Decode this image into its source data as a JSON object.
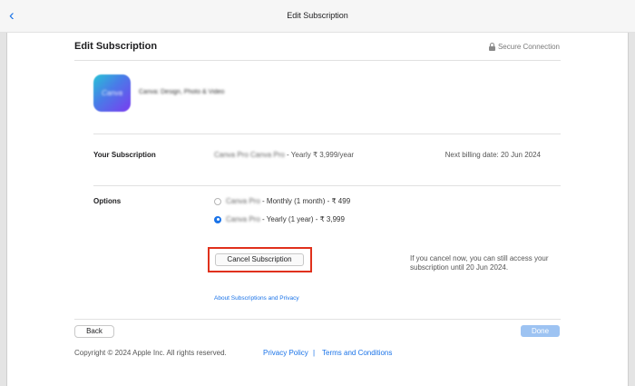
{
  "window": {
    "title": "Edit Subscription"
  },
  "header": {
    "title": "Edit Subscription",
    "secure_label": "Secure Connection"
  },
  "app": {
    "name": "Canva: Design, Photo & Video",
    "icon_text": "Canva"
  },
  "subscription": {
    "label": "Your Subscription",
    "plan_blurred": "Canva Pro Canva Pro",
    "plan_suffix": " - Yearly ₹ 3,999/year",
    "next_billing": "Next billing date: 20 Jun 2024"
  },
  "options": {
    "label": "Options",
    "items": [
      {
        "blurred": "Canva Pro",
        "suffix": " - Monthly (1 month) - ₹ 499",
        "selected": false
      },
      {
        "blurred": "Canva Pro",
        "suffix": " - Yearly (1 year) - ₹ 3,999",
        "selected": true
      }
    ]
  },
  "cancel": {
    "button_label": "Cancel Subscription",
    "note": "If you cancel now, you can still access your subscription until 20 Jun 2024."
  },
  "links": {
    "about": "About Subscriptions and Privacy"
  },
  "footer": {
    "back_label": "Back",
    "done_label": "Done",
    "copyright": "Copyright © 2024 Apple Inc. All rights reserved.",
    "privacy": "Privacy Policy",
    "separator": "|",
    "terms": "Terms and Conditions"
  },
  "colors": {
    "accent": "#1a73e8",
    "highlight": "#e0311c",
    "done_disabled": "#9dc3f2"
  },
  "icons": {
    "back": "chevron-left-icon",
    "lock": "lock-icon"
  }
}
